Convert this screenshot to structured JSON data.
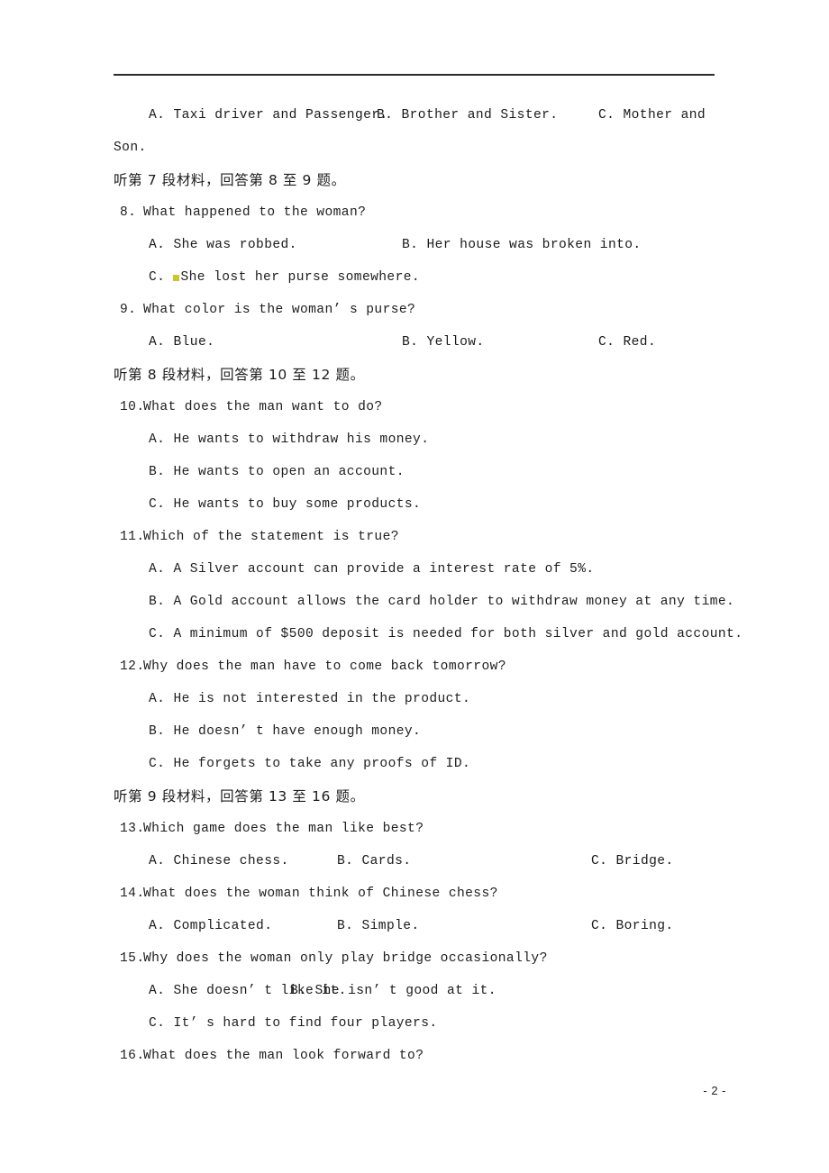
{
  "page": {
    "footer_page_label": "- 2 -"
  },
  "content": {
    "q7_options_line1": {
      "a": "A. Taxi driver and Passenger.",
      "b": "B. Brother and Sister.",
      "c": "C. Mother and"
    },
    "q7_options_line2": "Son.",
    "heading_7": "听第 7 段材料，回答第 8 至 9 题。",
    "q8": {
      "stem_num": "8.",
      "stem": "What happened to the woman?",
      "a": "A. She was robbed.",
      "b": "B. Her house was broken into.",
      "c_prefix": "C. ",
      "c": "She lost her purse somewhere."
    },
    "q9": {
      "stem_num": "9.",
      "stem": "What color is the woman’ s purse?",
      "a": "A. Blue.",
      "b": "B. Yellow.",
      "c": "C. Red."
    },
    "heading_8": "听第 8 段材料，回答第 10 至 12 题。",
    "q10": {
      "stem_num": "10.",
      "stem": "What does the man want to do?",
      "a": "A. He wants to withdraw his money.",
      "b": "B. He wants to open an account.",
      "c": "C. He wants to buy some products."
    },
    "q11": {
      "stem_num": "11.",
      "stem": "Which of the statement is true?",
      "a": "A. A Silver account can provide a interest rate of 5%.",
      "b": "B. A Gold account allows the card holder to withdraw money at any time.",
      "c": "C. A minimum of $500 deposit is needed for both silver and gold account."
    },
    "q12": {
      "stem_num": "12.",
      "stem": "Why does the man have to come back tomorrow?",
      "a": "A. He is not interested in the product.",
      "b": "B. He doesn’ t have enough money.",
      "c": "C. He forgets to take any proofs of ID."
    },
    "heading_9": "听第 9 段材料，回答第 13 至 16 题。",
    "q13": {
      "stem_num": "13.",
      "stem": "Which game does the man like best?",
      "a": "A. Chinese chess.",
      "b": "B. Cards.",
      "c": "C. Bridge."
    },
    "q14": {
      "stem_num": "14.",
      "stem": "What does the woman think of Chinese chess?",
      "a": "A. Complicated.",
      "b": "B. Simple.",
      "c": "C. Boring."
    },
    "q15": {
      "stem_num": "15.",
      "stem": "Why does the woman only play bridge occasionally?",
      "a": "A. She doesn’ t like it.",
      "b": "B. She isn’ t good at it.",
      "c": "C. It’ s hard to find four players."
    },
    "q16": {
      "stem_num": "16.",
      "stem": "What does the man look forward to?"
    }
  },
  "colors": {
    "text": "#202020",
    "rule": "#2b2b2b",
    "highlight_mark": "#c8c82a"
  }
}
